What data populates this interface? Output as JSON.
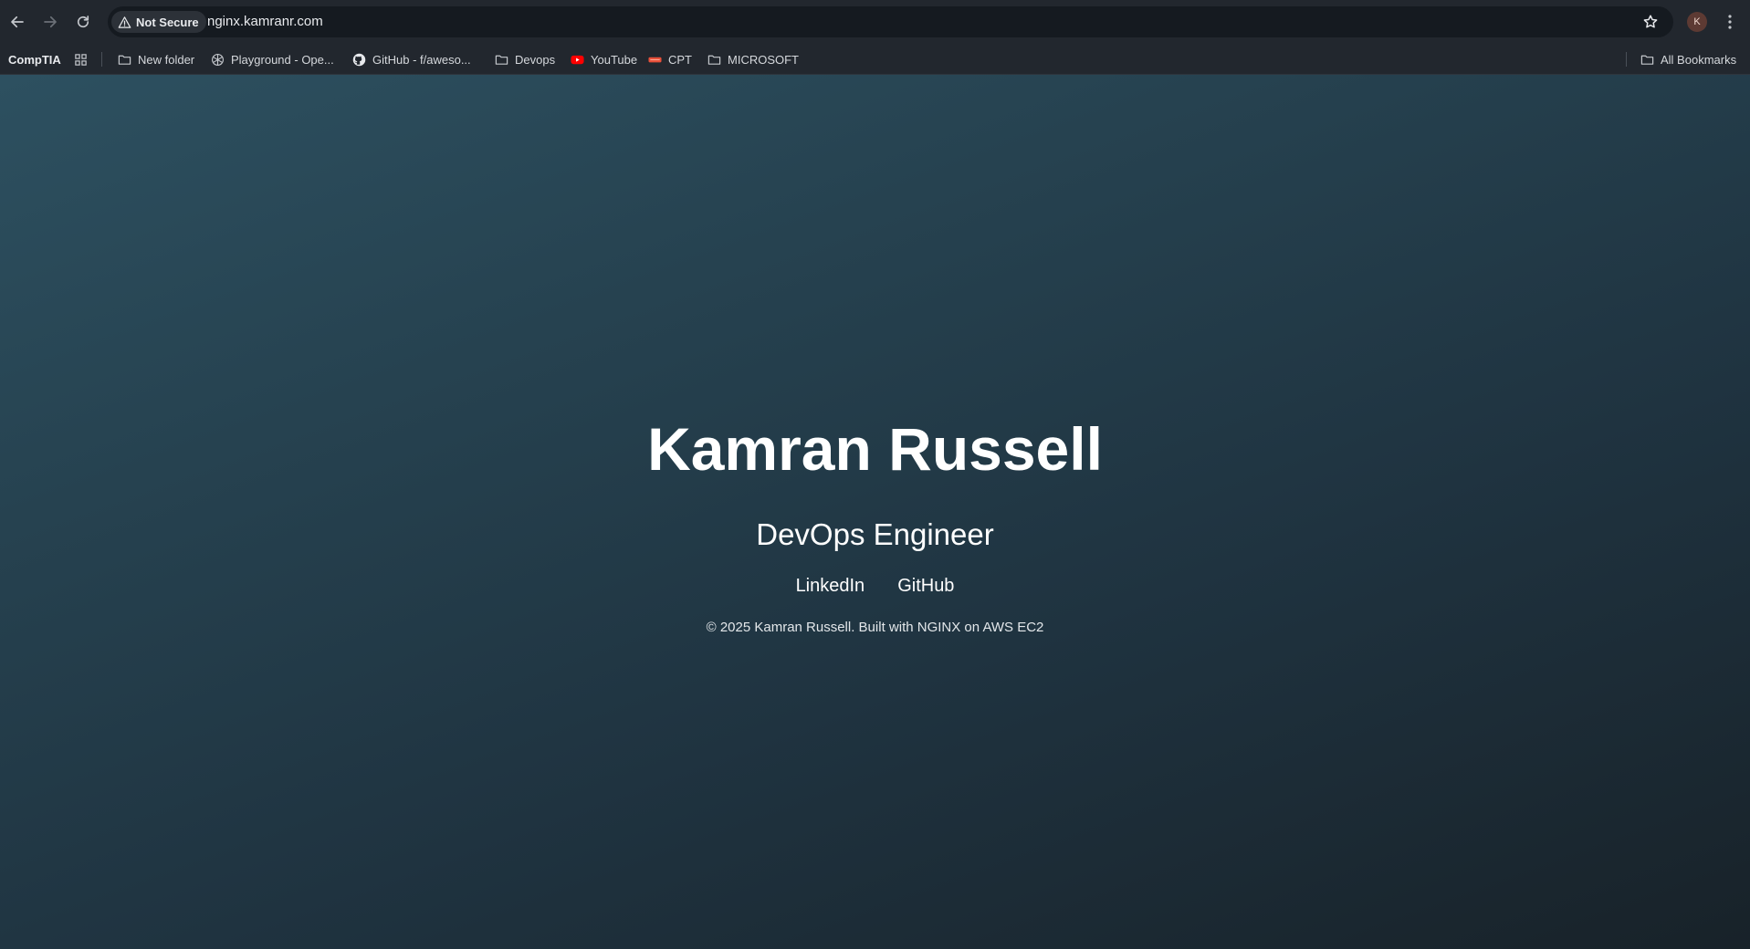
{
  "browser": {
    "security_label": "Not Secure",
    "url": "nginx.kamranr.com",
    "profile_initial": "K"
  },
  "bookmarks": {
    "items": [
      {
        "label": "CompTIA",
        "icon": "none"
      },
      {
        "label": "New folder",
        "icon": "folder-icon"
      },
      {
        "label": "Playground - Ope...",
        "icon": "openai-icon"
      },
      {
        "label": "GitHub - f/aweso...",
        "icon": "github-icon"
      },
      {
        "label": "Devops",
        "icon": "folder-icon"
      },
      {
        "label": "YouTube",
        "icon": "youtube-icon"
      },
      {
        "label": "CPT",
        "icon": "cpt-icon"
      },
      {
        "label": "MICROSOFT",
        "icon": "folder-icon"
      }
    ],
    "all_bookmarks_label": "All Bookmarks"
  },
  "page": {
    "name": "Kamran Russell",
    "role": "DevOps Engineer",
    "links": [
      "LinkedIn",
      "GitHub"
    ],
    "footer": "© 2025 Kamran Russell. Built with NGINX on AWS EC2"
  },
  "colors": {
    "chrome_bg": "#22272e",
    "omnibox_bg": "#151a20",
    "page_gradient_start": "#2d5060",
    "page_gradient_end": "#182229",
    "youtube_red": "#ff0000",
    "cpt_accent": "#e8503a"
  }
}
